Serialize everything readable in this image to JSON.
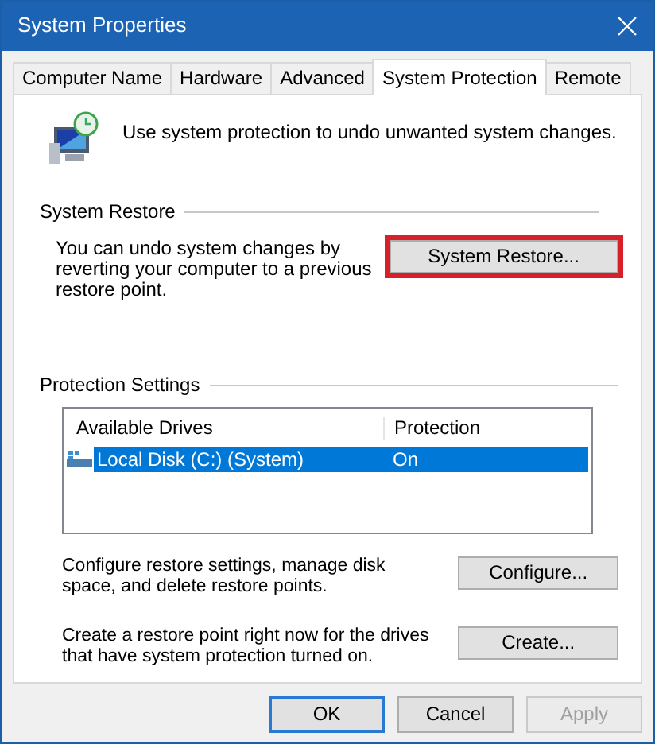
{
  "window": {
    "title": "System Properties"
  },
  "tabs": [
    {
      "label": "Computer Name",
      "selected": false
    },
    {
      "label": "Hardware",
      "selected": false
    },
    {
      "label": "Advanced",
      "selected": false
    },
    {
      "label": "System Protection",
      "selected": true
    },
    {
      "label": "Remote",
      "selected": false
    }
  ],
  "intro": "Use system protection to undo unwanted system changes.",
  "system_restore": {
    "label": "System Restore",
    "text": "You can undo system changes by reverting your computer to a previous restore point.",
    "button": {
      "label": "System Restore...",
      "highlighted": true
    }
  },
  "protection_settings": {
    "label": "Protection Settings",
    "columns": [
      "Available Drives",
      "Protection"
    ],
    "rows": [
      {
        "drive": "Local Disk (C:) (System)",
        "protection": "On",
        "selected": true
      }
    ],
    "actions": [
      {
        "text": "Configure restore settings, manage disk space, and delete restore points.",
        "button": {
          "label": "Configure..."
        }
      },
      {
        "text": "Create a restore point right now for the drives that have system protection turned on.",
        "button": {
          "label": "Create..."
        }
      }
    ]
  },
  "buttons": [
    {
      "label": "OK",
      "default": true,
      "disabled": false
    },
    {
      "label": "Cancel",
      "default": false,
      "disabled": false
    },
    {
      "label": "Apply",
      "default": false,
      "disabled": true
    }
  ]
}
